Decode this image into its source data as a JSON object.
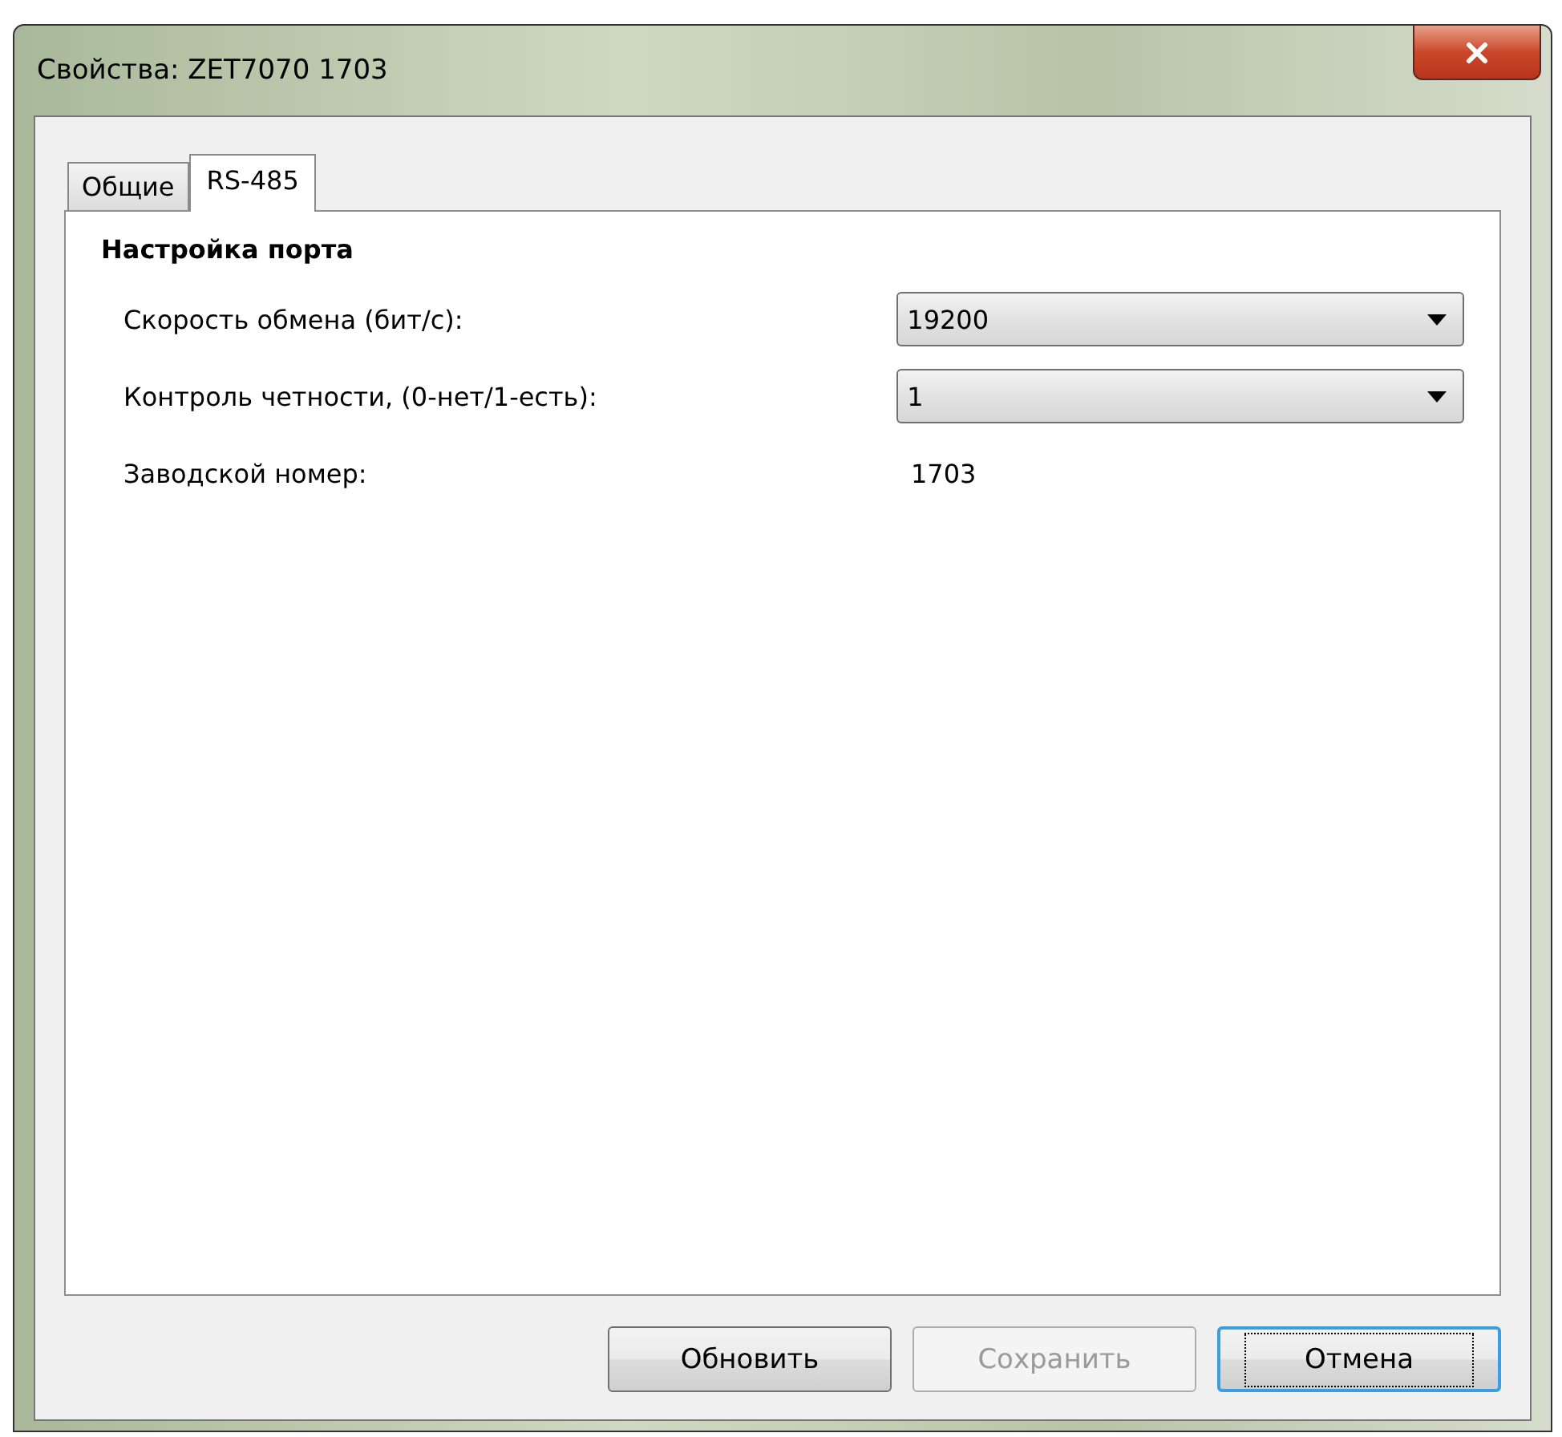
{
  "window": {
    "title": "Свойства: ZET7070 1703"
  },
  "tabs": [
    {
      "label": "Общие",
      "selected": false
    },
    {
      "label": "RS-485",
      "selected": true
    }
  ],
  "section_title": "Настройка порта",
  "fields": [
    {
      "kind": "dropdown",
      "label": "Скорость обмена (бит/с):",
      "value": "19200"
    },
    {
      "kind": "dropdown",
      "label": "Контроль четности, (0-нет/1-есть):",
      "value": "1"
    },
    {
      "kind": "text",
      "label": "Заводской номер:",
      "value": "1703"
    }
  ],
  "buttons": [
    {
      "label": "Обновить",
      "disabled": false,
      "focused": false
    },
    {
      "label": "Сохранить",
      "disabled": true,
      "focused": false
    },
    {
      "label": "Отмена",
      "disabled": false,
      "focused": true
    }
  ]
}
